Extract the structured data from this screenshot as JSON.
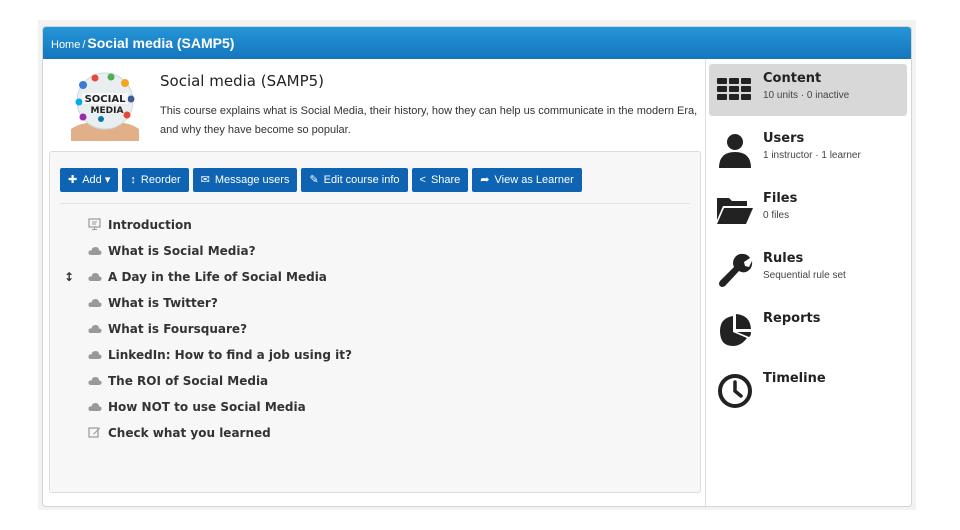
{
  "breadcrumb": {
    "home": "Home",
    "separator": "/",
    "current": "Social media (SAMP5)"
  },
  "course": {
    "title": "Social media (SAMP5)",
    "description": "This course explains what is Social Media, their history, how they can help us communicate in the modern Era, and why they have become so popular.",
    "thumbnail_text": [
      "SOCIAL",
      "MEDIA"
    ]
  },
  "toolbar": {
    "add": "Add",
    "reorder": "Reorder",
    "message_users": "Message users",
    "edit_course_info": "Edit course info",
    "share": "Share",
    "view_as_learner": "View as Learner"
  },
  "units": [
    {
      "label": "Introduction",
      "icon": "presentation-icon"
    },
    {
      "label": "What is Social Media?",
      "icon": "cloud-icon"
    },
    {
      "label": "A Day in the Life of Social Media",
      "icon": "cloud-icon"
    },
    {
      "label": "What is Twitter?",
      "icon": "cloud-icon"
    },
    {
      "label": "What is Foursquare?",
      "icon": "cloud-icon"
    },
    {
      "label": "LinkedIn: How to find a job using it?",
      "icon": "cloud-icon"
    },
    {
      "label": "The ROI of Social Media",
      "icon": "cloud-icon"
    },
    {
      "label": "How NOT to use Social Media",
      "icon": "cloud-icon"
    },
    {
      "label": "Check what you learned",
      "icon": "edit-icon"
    }
  ],
  "reorder_handle_on_unit": 2,
  "sidebar": {
    "content": {
      "label": "Content",
      "sub": "10 units · 0 inactive"
    },
    "users": {
      "label": "Users",
      "sub": "1 instructor · 1 learner"
    },
    "files": {
      "label": "Files",
      "sub": "0 files"
    },
    "rules": {
      "label": "Rules",
      "sub": "Sequential rule set"
    },
    "reports": {
      "label": "Reports"
    },
    "timeline": {
      "label": "Timeline"
    }
  },
  "colors": {
    "header_blue": "#1a80c8",
    "button_blue": "#0f63b3",
    "active_item": "#d8d8d8"
  }
}
